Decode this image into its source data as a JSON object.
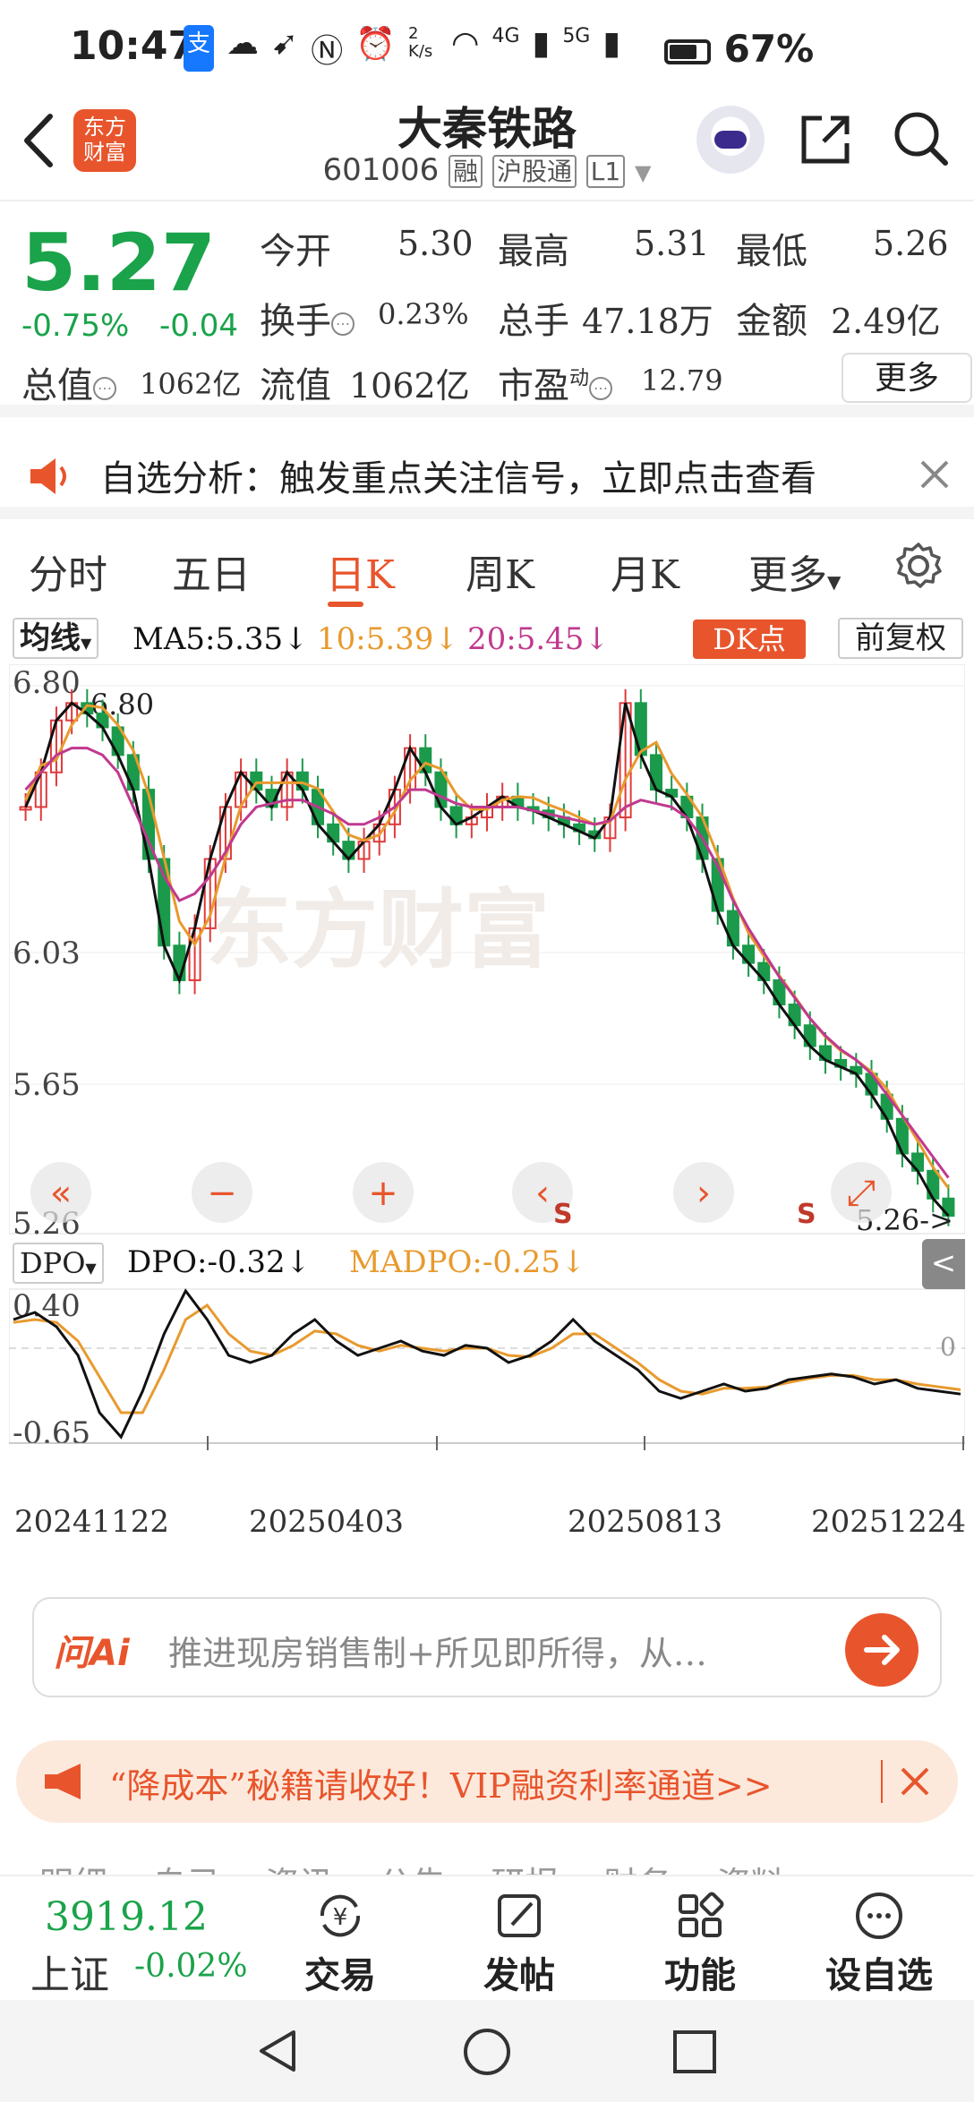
{
  "status_bar": {
    "time": "10:47",
    "net_speed": "2 K/s",
    "signal_1": "4G",
    "signal_2": "5G",
    "battery": "67%"
  },
  "header": {
    "logo_text": "东方财富",
    "title": "大秦铁路",
    "code": "601006",
    "tag_margin": "融",
    "tag_connect": "沪股通",
    "tag_level": "L1"
  },
  "quote": {
    "price": "5.27",
    "change_pct": "-0.75%",
    "change_abs": "-0.04",
    "open_label": "今开",
    "open_value": "5.30",
    "high_label": "最高",
    "high_value": "5.31",
    "low_label": "最低",
    "low_value": "5.26",
    "turnover_label": "换手",
    "turnover_value": "0.23%",
    "volume_label": "总手",
    "volume_value": "47.18万",
    "amount_label": "金额",
    "amount_value": "2.49亿",
    "mktcap_label": "总值",
    "mktcap_value": "1062亿",
    "float_label": "流值",
    "float_value": "1062亿",
    "pe_label": "市盈",
    "pe_sup": "动",
    "pe_value": "12.79",
    "more_label": "更多"
  },
  "notice": {
    "text": "自选分析：触发重点关注信号，立即点击查看"
  },
  "tabs": [
    {
      "label": "分时"
    },
    {
      "label": "五日"
    },
    {
      "label": "日K"
    },
    {
      "label": "周K"
    },
    {
      "label": "月K"
    },
    {
      "label": "更多"
    }
  ],
  "ma_row": {
    "selector": "均线",
    "ma5": "MA5:5.35↓",
    "ma10": "10:5.39↓",
    "ma20": "20:5.45↓",
    "dk_badge": "DK点",
    "adjust": "前复权",
    "ma5_color": "#111111",
    "ma10_color": "#e89a2e",
    "ma20_color": "#c0398f"
  },
  "chart_data": {
    "type": "candlestick",
    "y_labels": [
      "6.80",
      "6.03",
      "5.65",
      "5.26"
    ],
    "high_marker": "-6.80",
    "last_marker": "5.26->",
    "watermark": "东方财富",
    "x_labels": [
      "20241122",
      "20250403",
      "20250813",
      "20251224"
    ],
    "close_series": [
      6.45,
      6.55,
      6.7,
      6.75,
      6.72,
      6.68,
      6.6,
      6.5,
      6.3,
      6.05,
      5.95,
      6.1,
      6.3,
      6.45,
      6.55,
      6.5,
      6.45,
      6.55,
      6.5,
      6.4,
      6.35,
      6.3,
      6.35,
      6.4,
      6.5,
      6.62,
      6.55,
      6.45,
      6.4,
      6.42,
      6.45,
      6.48,
      6.45,
      6.44,
      6.42,
      6.4,
      6.38,
      6.36,
      6.42,
      6.75,
      6.6,
      6.5,
      6.48,
      6.42,
      6.3,
      6.15,
      6.05,
      6.0,
      5.95,
      5.88,
      5.82,
      5.76,
      5.72,
      5.7,
      5.68,
      5.62,
      5.55,
      5.45,
      5.4,
      5.32,
      5.27
    ],
    "ma20_series": [
      6.5,
      6.55,
      6.6,
      6.62,
      6.62,
      6.6,
      6.55,
      6.45,
      6.35,
      6.25,
      6.18,
      6.2,
      6.25,
      6.32,
      6.4,
      6.45,
      6.46,
      6.47,
      6.47,
      6.45,
      6.43,
      6.4,
      6.4,
      6.42,
      6.45,
      6.5,
      6.5,
      6.48,
      6.46,
      6.45,
      6.45,
      6.45,
      6.45,
      6.44,
      6.43,
      6.42,
      6.41,
      6.4,
      6.41,
      6.45,
      6.47,
      6.46,
      6.45,
      6.42,
      6.36,
      6.28,
      6.18,
      6.1,
      6.03,
      5.96,
      5.9,
      5.84,
      5.79,
      5.75,
      5.72,
      5.68,
      5.62,
      5.56,
      5.5,
      5.44,
      5.38
    ],
    "dpo_label": "DPO",
    "dpo_value": "DPO:-0.32↓",
    "madpo_value": "MADPO:-0.25↓",
    "dpo_ylabels": [
      "0.40",
      "-0.65"
    ],
    "dpo_zero": "0",
    "dpo_series": [
      0.2,
      0.25,
      0.15,
      -0.05,
      -0.45,
      -0.62,
      -0.3,
      0.1,
      0.4,
      0.2,
      -0.05,
      -0.1,
      -0.05,
      0.1,
      0.2,
      0.05,
      -0.05,
      0.0,
      0.05,
      -0.02,
      -0.05,
      0.02,
      0.0,
      -0.1,
      -0.05,
      0.05,
      0.2,
      0.05,
      -0.05,
      -0.15,
      -0.3,
      -0.35,
      -0.3,
      -0.25,
      -0.3,
      -0.28,
      -0.22,
      -0.2,
      -0.18,
      -0.2,
      -0.25,
      -0.22,
      -0.28,
      -0.3,
      -0.32
    ],
    "madpo_series": [
      0.18,
      0.2,
      0.18,
      0.05,
      -0.2,
      -0.45,
      -0.45,
      -0.15,
      0.2,
      0.3,
      0.1,
      -0.02,
      -0.05,
      0.02,
      0.12,
      0.1,
      0.02,
      -0.02,
      0.02,
      0.0,
      -0.02,
      0.0,
      0.0,
      -0.05,
      -0.06,
      0.0,
      0.1,
      0.1,
      0.0,
      -0.1,
      -0.22,
      -0.3,
      -0.32,
      -0.28,
      -0.28,
      -0.27,
      -0.24,
      -0.21,
      -0.19,
      -0.19,
      -0.22,
      -0.22,
      -0.25,
      -0.27,
      -0.29
    ]
  },
  "chart_controls": {
    "collapse": "<",
    "signal_s": "S"
  },
  "ask_ai": {
    "brand": "问Ai",
    "placeholder": "推进现房销售制+所见即所得，从…"
  },
  "promo": {
    "text": "“降成本”秘籍请收好！VIP融资利率通道>>"
  },
  "bottom_nav": {
    "index_value": "3919.12",
    "index_name": "上证",
    "index_change": "-0.02%",
    "items": [
      {
        "label": "交易",
        "icon": "yuan-cycle-icon"
      },
      {
        "label": "发帖",
        "icon": "edit-icon"
      },
      {
        "label": "功能",
        "icon": "grid-icon"
      },
      {
        "label": "设自选",
        "icon": "more-dots-icon"
      }
    ],
    "hidden_tabs": "明细 自己 资讯 公告 研报 财务 资料"
  }
}
